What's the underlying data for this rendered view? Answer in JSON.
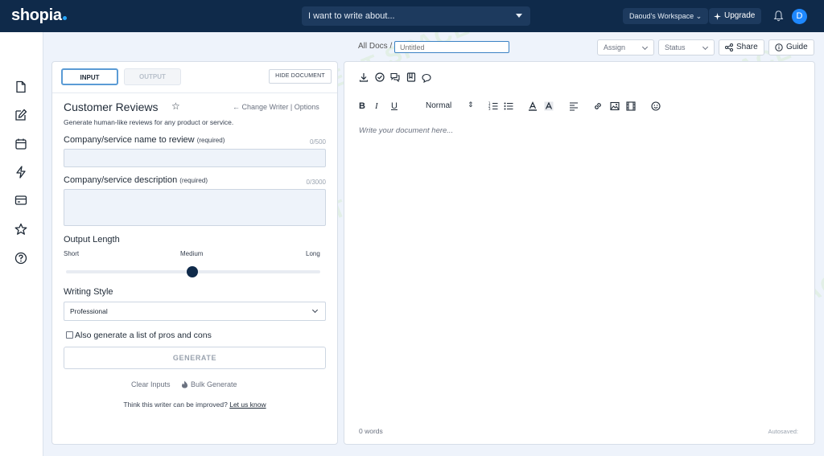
{
  "app": {
    "logo": "shopia",
    "prompt_placeholder": "I want to write about...",
    "workspace": "Daoud's Workspace",
    "upgrade_label": "Upgrade",
    "avatar_initial": "D"
  },
  "sidebar": {
    "items": [
      {
        "icon": "document-icon"
      },
      {
        "icon": "edit-icon"
      },
      {
        "icon": "calendar-icon"
      },
      {
        "icon": "lightning-icon"
      },
      {
        "icon": "credit-card-icon"
      },
      {
        "icon": "star-icon"
      },
      {
        "icon": "help-icon"
      }
    ]
  },
  "doc_header": {
    "breadcrumb": "All Docs /",
    "title_placeholder": "Untitled",
    "assign_label": "Assign",
    "status_label": "Status",
    "share_label": "Share",
    "guide_label": "Guide"
  },
  "input_panel": {
    "tabs": {
      "input": "INPUT",
      "output": "OUTPUT"
    },
    "hide_document": "HIDE DOCUMENT",
    "writer_title": "Customer Reviews",
    "change_writer": "← Change Writer | Options",
    "writer_description": "Generate human-like reviews for any product or service.",
    "fields": [
      {
        "label": "Company/service name to review",
        "required": "(required)",
        "counter": "0/500",
        "value": ""
      },
      {
        "label": "Company/service description",
        "required": "(required)",
        "counter": "0/3000",
        "value": ""
      }
    ],
    "output_length": {
      "label": "Output Length",
      "options": [
        "Short",
        "Medium",
        "Long"
      ],
      "selected": "Medium",
      "position_fraction": 0.5
    },
    "writing_style": {
      "label": "Writing Style",
      "value": "Professional"
    },
    "pros_cons": {
      "label": "Also generate a list of pros and cons",
      "checked": false
    },
    "generate_label": "GENERATE",
    "clear_inputs": "Clear Inputs",
    "bulk_generate": "Bulk Generate",
    "feedback_text": "Think this writer can be improved?",
    "feedback_link": "Let us know"
  },
  "editor": {
    "toolbar_top": [
      "download-icon",
      "check-circle-icon",
      "comments-icon",
      "book-icon",
      "chat-icon"
    ],
    "format_select": "Normal",
    "placeholder": "Write your document here...",
    "word_count": "0 words",
    "autosaved": "Autosaved:"
  },
  "watermark_text": "AI TALENT SPACE",
  "colors": {
    "topbar": "#0f2a4a",
    "accent": "#1e88ff",
    "background": "#eef3fb"
  }
}
